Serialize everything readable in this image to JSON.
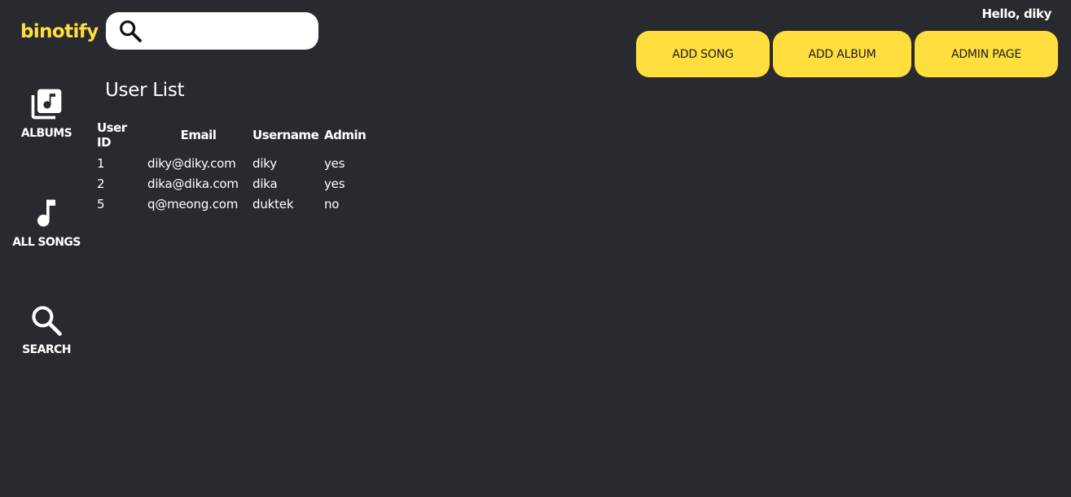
{
  "header": {
    "logo": "binotify",
    "search": {
      "placeholder": "",
      "value": ""
    },
    "greeting": "Hello, diky",
    "buttons": {
      "add_song": "ADD SONG",
      "add_album": "ADD ALBUM",
      "admin_page": "ADMIN PAGE"
    }
  },
  "sidebar": {
    "items": [
      {
        "label": "ALBUMS",
        "icon": "album-library-icon"
      },
      {
        "label": "ALL SONGS",
        "icon": "music-note-icon"
      },
      {
        "label": "SEARCH",
        "icon": "search-icon"
      }
    ]
  },
  "main": {
    "title": "User List",
    "table": {
      "headers": [
        "User ID",
        "Email",
        "Username",
        "Admin"
      ],
      "rows": [
        [
          "1",
          "diky@diky.com",
          "diky",
          "yes"
        ],
        [
          "2",
          "dika@dika.com",
          "dika",
          "yes"
        ],
        [
          "5",
          "q@meong.com",
          "duktek",
          "no"
        ]
      ]
    }
  },
  "colors": {
    "background": "#292a30",
    "accent": "#ffde3d",
    "text": "#ffffff"
  }
}
